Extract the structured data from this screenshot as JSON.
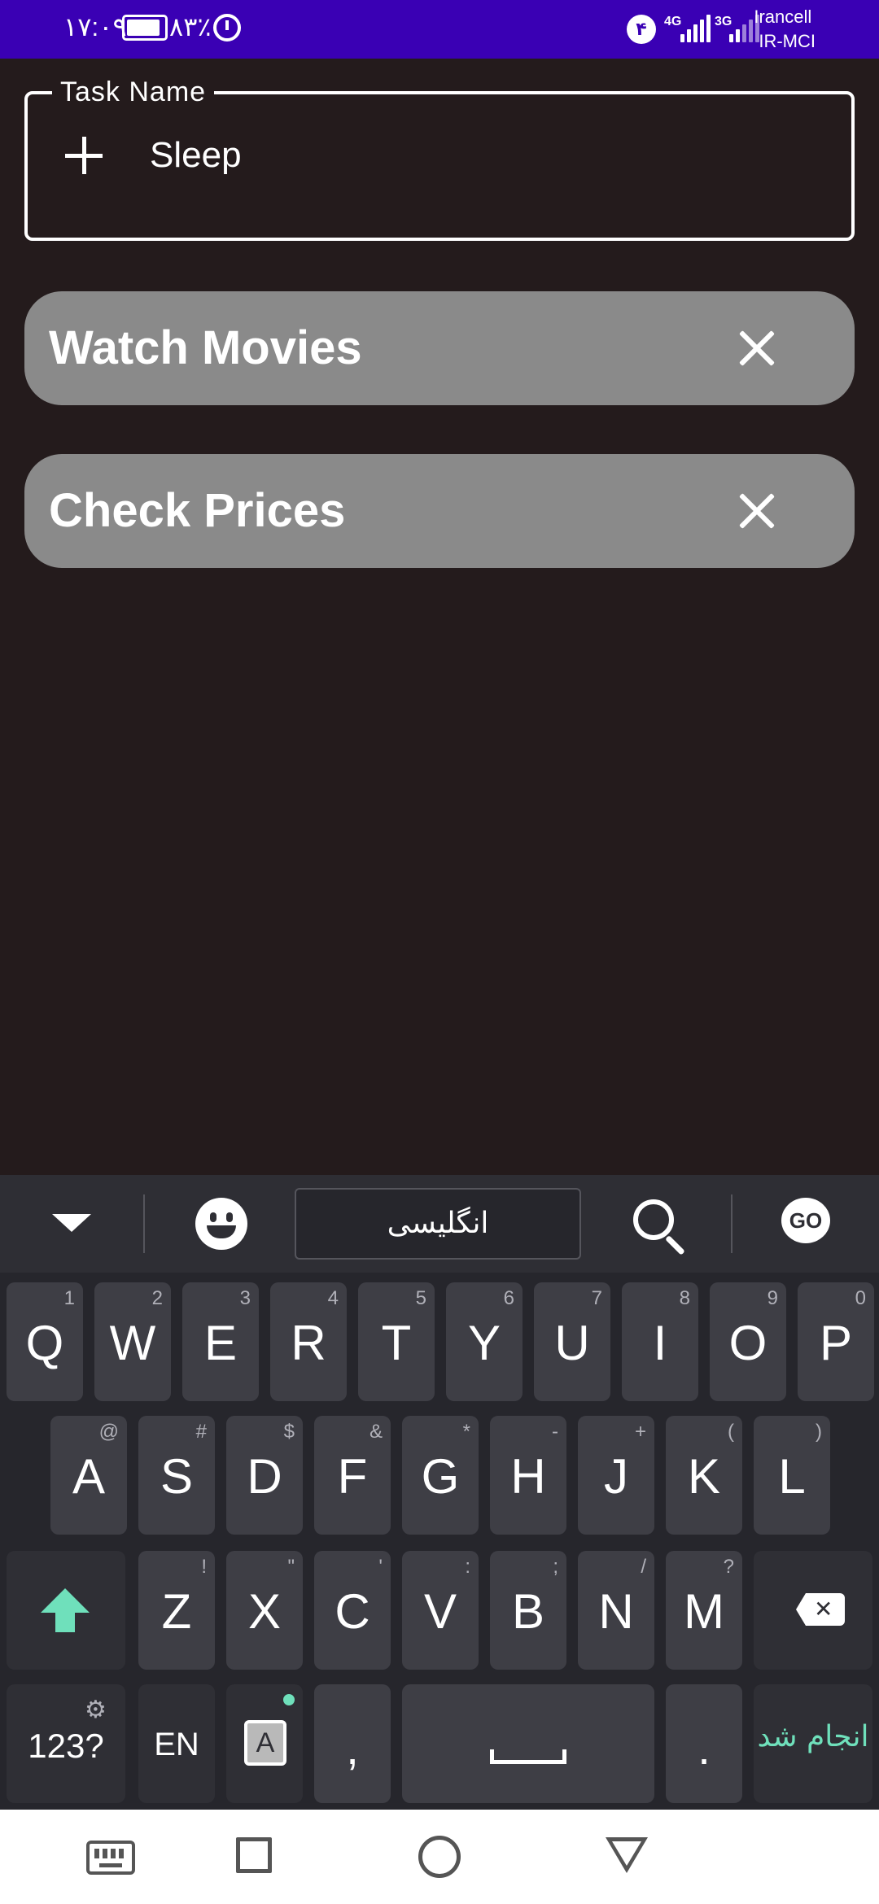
{
  "status_bar": {
    "time": "۱۷:۰۹",
    "battery_percent": "۸۳٪",
    "notification_count": "۴",
    "network_1": "4G",
    "network_2": "3G",
    "carrier_1": "Irancell",
    "carrier_2": "IR-MCI"
  },
  "task_input": {
    "label": "Task Name",
    "value": "Sleep",
    "add_icon": "plus-icon"
  },
  "tasks": [
    {
      "title": "Watch Movies",
      "remove_icon": "close-icon"
    },
    {
      "title": "Check Prices",
      "remove_icon": "close-icon"
    }
  ],
  "keyboard": {
    "toolbar": {
      "language": "انگلیسی",
      "go_logo": "GO"
    },
    "row1": [
      {
        "main": "Q",
        "sup": "1"
      },
      {
        "main": "W",
        "sup": "2"
      },
      {
        "main": "E",
        "sup": "3"
      },
      {
        "main": "R",
        "sup": "4"
      },
      {
        "main": "T",
        "sup": "5"
      },
      {
        "main": "Y",
        "sup": "6"
      },
      {
        "main": "U",
        "sup": "7"
      },
      {
        "main": "I",
        "sup": "8"
      },
      {
        "main": "O",
        "sup": "9"
      },
      {
        "main": "P",
        "sup": "0"
      }
    ],
    "row2": [
      {
        "main": "A",
        "sup": "@"
      },
      {
        "main": "S",
        "sup": "#"
      },
      {
        "main": "D",
        "sup": "$"
      },
      {
        "main": "F",
        "sup": "&"
      },
      {
        "main": "G",
        "sup": "*"
      },
      {
        "main": "H",
        "sup": "-"
      },
      {
        "main": "J",
        "sup": "+"
      },
      {
        "main": "K",
        "sup": "("
      },
      {
        "main": "L",
        "sup": ")"
      }
    ],
    "row3": [
      {
        "main": "Z",
        "sup": "!"
      },
      {
        "main": "X",
        "sup": "\""
      },
      {
        "main": "C",
        "sup": "'"
      },
      {
        "main": "V",
        "sup": ":"
      },
      {
        "main": "B",
        "sup": ";"
      },
      {
        "main": "N",
        "sup": "/"
      },
      {
        "main": "M",
        "sup": "?"
      }
    ],
    "bottom": {
      "symbols": "123?",
      "lang": "EN",
      "comma": ",",
      "period": ".",
      "done": "انجام شد"
    },
    "accent_color": "#6fe0bb"
  },
  "colors": {
    "status_bar": "#3a00b4",
    "background": "#241b1c",
    "card": "#8a8a8a"
  }
}
